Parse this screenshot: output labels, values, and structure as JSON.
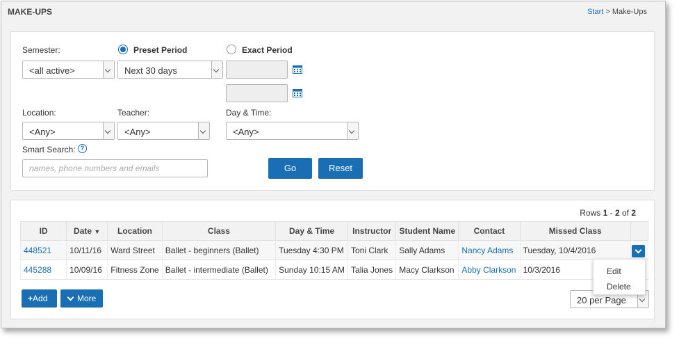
{
  "header": {
    "title": "MAKE-UPS",
    "crumb_start": "Start",
    "crumb_sep": " > ",
    "crumb_current": "Make-Ups"
  },
  "filters": {
    "semester_label": "Semester:",
    "semester_value": "<all active>",
    "preset_period_label": "Preset Period",
    "preset_period_value": "Next 30 days",
    "exact_period_label": "Exact Period",
    "location_label": "Location:",
    "location_value": "<Any>",
    "teacher_label": "Teacher:",
    "teacher_value": "<Any>",
    "daytime_label": "Day & Time:",
    "daytime_value": "<Any>",
    "smart_search_label": "Smart Search:",
    "smart_search_help": "?",
    "smart_search_placeholder": "names, phone numbers and emails",
    "go_label": "Go",
    "reset_label": "Reset"
  },
  "results": {
    "rows_prefix": "Rows ",
    "rows_from": "1",
    "rows_dash": " - ",
    "rows_to": "2",
    "rows_of": " of ",
    "rows_total": "2",
    "columns": [
      "ID",
      "Date",
      "Location",
      "Class",
      "Day & Time",
      "Instructor",
      "Student Name",
      "Contact",
      "Missed Class"
    ],
    "sort_indicator": "▼",
    "rows": [
      {
        "id": "448521",
        "date": "10/11/16",
        "location": "Ward Street",
        "class": "Ballet - beginners (Ballet)",
        "day_time": "Tuesday 4:30 PM",
        "instructor": "Toni Clark",
        "student": "Sally Adams",
        "contact": "Nancy Adams",
        "missed": "Tuesday, 10/4/2016"
      },
      {
        "id": "445288",
        "date": "10/09/16",
        "location": "Fitness Zone",
        "class": "Ballet - intermediate (Ballet)",
        "day_time": "Sunday 10:15 AM",
        "instructor": "Talia Jones",
        "student": "Macy Clarkson",
        "contact": "Abby Clarkson",
        "missed": "10/3/2016"
      }
    ],
    "row_menu": [
      "Edit",
      "Delete"
    ],
    "add_label": "Add",
    "more_label": "More",
    "per_page_value": "20 per Page"
  },
  "colors": {
    "accent": "#1a6fb4",
    "background": "#f2f2f2"
  }
}
